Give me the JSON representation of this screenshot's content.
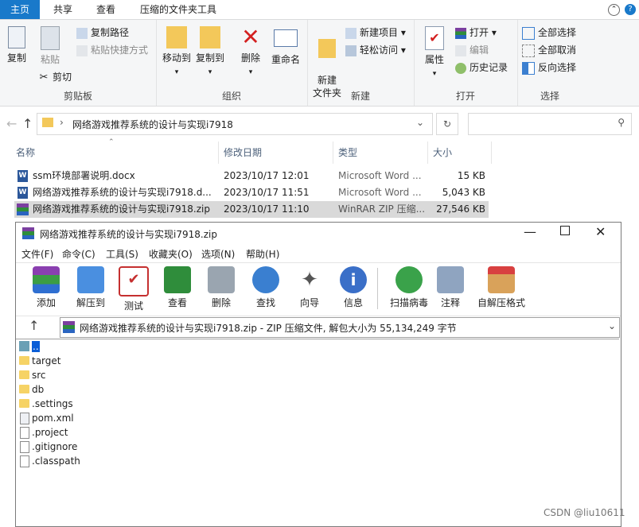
{
  "explorer": {
    "tabs": [
      "主页",
      "共享",
      "查看",
      "压缩的文件夹工具"
    ],
    "ribbon": {
      "clipboard": {
        "label": "剪贴板",
        "copy": "复制",
        "paste": "粘贴",
        "copy_path": "复制路径",
        "paste_shortcut": "粘贴快捷方式",
        "cut": "剪切"
      },
      "organize": {
        "label": "组织",
        "move_to": "移动到",
        "copy_to": "复制到",
        "delete": "删除",
        "rename": "重命名"
      },
      "new": {
        "label": "新建",
        "new_folder": "新建\n文件夹",
        "new_item": "新建项目",
        "easy_access": "轻松访问"
      },
      "open": {
        "label": "打开",
        "properties": "属性",
        "open": "打开",
        "edit": "编辑",
        "history": "历史记录"
      },
      "select": {
        "label": "选择",
        "select_all": "全部选择",
        "select_none": "全部取消",
        "invert": "反向选择"
      }
    },
    "path": "网络游戏推荐系统的设计与实现i7918",
    "columns": [
      "名称",
      "修改日期",
      "类型",
      "大小"
    ],
    "files": [
      {
        "name": "ssm环境部署说明.docx",
        "date": "2023/10/17 12:01",
        "type": "Microsoft Word ...",
        "size": "15 KB",
        "icon": "word-icon"
      },
      {
        "name": "网络游戏推荐系统的设计与实现i7918.d...",
        "date": "2023/10/17 11:51",
        "type": "Microsoft Word ...",
        "size": "5,043 KB",
        "icon": "word-icon"
      },
      {
        "name": "网络游戏推荐系统的设计与实现i7918.zip",
        "date": "2023/10/17 11:10",
        "type": "WinRAR ZIP 压缩...",
        "size": "27,546 KB",
        "icon": "winrar-icon"
      }
    ]
  },
  "winrar": {
    "title": "网络游戏推荐系统的设计与实现i7918.zip",
    "menu": [
      "文件(F)",
      "命令(C)",
      "工具(S)",
      "收藏夹(O)",
      "选项(N)",
      "帮助(H)"
    ],
    "toolbar": [
      "添加",
      "解压到",
      "测试",
      "查看",
      "删除",
      "查找",
      "向导",
      "信息",
      "扫描病毒",
      "注释",
      "自解压格式"
    ],
    "path": "网络游戏推荐系统的设计与实现i7918.zip - ZIP 压缩文件, 解包大小为 55,134,249 字节",
    "items": [
      {
        "name": "..",
        "kind": "up"
      },
      {
        "name": "target",
        "kind": "folder"
      },
      {
        "name": "src",
        "kind": "folder"
      },
      {
        "name": "db",
        "kind": "folder"
      },
      {
        "name": ".settings",
        "kind": "folder"
      },
      {
        "name": "pom.xml",
        "kind": "xml"
      },
      {
        "name": ".project",
        "kind": "file"
      },
      {
        "name": ".gitignore",
        "kind": "file"
      },
      {
        "name": ".classpath",
        "kind": "file"
      }
    ]
  },
  "watermark": "CSDN @liu10611"
}
